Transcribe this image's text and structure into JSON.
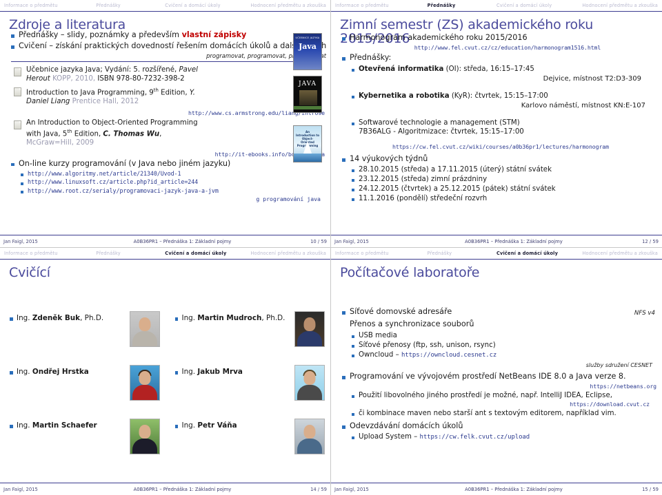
{
  "nav": {
    "items": [
      "Informace o předmětu",
      "Přednášky",
      "Cvičení a domácí úkoly",
      "Hodnocení předmětu a zkouška"
    ]
  },
  "footer": {
    "author": "Jan Faigl, 2015",
    "center": "A0B36PR1 – Přednáška 1: Základní pojmy"
  },
  "slides": [
    {
      "title": "Zdroje a literatura",
      "active_nav": 0,
      "page": "10 / 59",
      "bullets": [
        {
          "pre": "Přednášky – slidy, poznámky a především ",
          "red": "vlastní zápisky"
        },
        {
          "pre": "Cvičení – získání praktických dovedností řešením domácích úkolů a dalších úloh"
        }
      ],
      "note_right": "programovat, programovat, programovat",
      "books": [
        {
          "line1_plain": "Učebnice jazyka Java; Vydání: 5. rozšířené, ",
          "line1_ital": "Pavel",
          "line2_ital": "Herout",
          "line2_gray": "KOPP, 2010,",
          "line2_plain": " ISBN 978-80-7232-398-2",
          "url": ""
        },
        {
          "line1_plain": "Introduction to Java Programming, 9",
          "sup": "th",
          "line1_rest": " Edition, ",
          "line1_ital": "Y.",
          "line2_ital": "Daniel Liang",
          "line2_gray": "Prentice Hall, 2012",
          "url": "http://www.cs.armstrong.edu/liang/intro9e"
        },
        {
          "line1_plain": "An Introduction to Object-Oriented Programming",
          "line2_plain": "with Java, 5",
          "sup": "th",
          "line2_rest": " Edition, ",
          "line2_ital": "C. Thomas Wu",
          "line3_gray": "McGraw=Hill, 2009",
          "url": "http://it-ebooks.info/book/1908/a"
        }
      ],
      "online": {
        "heading": "On-line kurzy programování (v Java nebo jiném jazyku)",
        "links": [
          "http://www.algoritmy.net/article/21340/Uvod-1",
          "http://www.linuxsoft.cz/article.php?id_article=244",
          "http://www.root.cz/serialy/programovaci-jazyk-java-a-jvm"
        ],
        "trailing": "g programování java"
      },
      "covers": [
        {
          "name": "ucebnice-jazyka-java-cover",
          "label": "Java",
          "sub": "UČEBNICE JAZYKA"
        },
        {
          "name": "intro-java-programming-cover",
          "label": "JAVA"
        },
        {
          "name": "intro-oop-java-cover",
          "label": "An Introduction to Object-Oriented Programming"
        }
      ]
    },
    {
      "title": "Zimní semestr (ZS) akademického roku 2015/2016",
      "active_nav": 1,
      "page": "12 / 59",
      "harmonogram_label": "Harmonogram akademického roku 2015/2016",
      "harmonogram_url": "http://www.fel.cvut.cz/cz/education/harmonogram1516.html",
      "lectures_label": "Přednášky:",
      "lectures": [
        {
          "bold": "Otevřená informatika",
          "rest": " (OI): středa, 16:15–17:45",
          "room": "Dejvice, místnost T2:D3-309"
        },
        {
          "bold": "Kybernetika a robotika",
          "rest": " (KyR): čtvrtek, 15:15–17:00",
          "room": "Karlovo náměstí, místnost KN:E-107"
        },
        {
          "bold": "",
          "rest": "Softwarové technologie a management (STM)",
          "line2": "7B36ALG - Algoritmizace: čtvrtek, 15:15–17:00",
          "room": ""
        }
      ],
      "lectures_url": "https://cw.fel.cvut.cz/wiki/courses/a0b36pr1/lectures/harmonogram",
      "weeks_label": "14 výukových týdnů",
      "weeks": [
        "28.10.2015 (středa) a 17.11.2015 (úterý) státní svátek",
        "23.12.2015 (středa) zimní prázdniny",
        "24.12.2015 (čtvrtek) a 25.12.2015 (pátek) státní svátek",
        "11.1.2016 (pondělí) středeční rozvrh"
      ]
    },
    {
      "title": "Cvičící",
      "active_nav": 2,
      "page": "14 / 59",
      "people": [
        {
          "prefix": "Ing. ",
          "name": "Zdeněk Buk",
          "suffix": ", Ph.D.",
          "photo": "photo-zdenek-buk"
        },
        {
          "prefix": "Ing. ",
          "name": "Martin Mudroch",
          "suffix": ", Ph.D.",
          "photo": "photo-martin-mudroch"
        },
        {
          "prefix": "Ing. ",
          "name": "Ondřej Hrstka",
          "suffix": "",
          "photo": "photo-ondrej-hrstka"
        },
        {
          "prefix": "Ing. ",
          "name": "Jakub Mrva",
          "suffix": "",
          "photo": "photo-jakub-mrva"
        },
        {
          "prefix": "Ing. ",
          "name": "Martin Schaefer",
          "suffix": "",
          "photo": "photo-martin-schaefer"
        },
        {
          "prefix": "Ing. ",
          "name": "Petr Váňa",
          "suffix": "",
          "photo": "photo-petr-vana"
        }
      ]
    },
    {
      "title": "Počítačové laboratoře",
      "active_nav": 2,
      "page": "15 / 59",
      "net_home": "Síťové domovské adresáře",
      "nfs": "NFS v4",
      "transfer_label": "Přenos a synchronizace souborů",
      "transfer_items": [
        {
          "text": "USB media"
        },
        {
          "text": "Síťové přenosy (ftp, ssh, unison, rsync)"
        },
        {
          "text": "Owncloud – ",
          "url": "https://owncloud.cesnet.cz"
        }
      ],
      "cesnet_note": "služby sdružení CESNET",
      "netbeans_label": "Programování ve vývojovém prostředí NetBeans IDE 8.0 a Java verze 8.",
      "netbeans_url": "https://netbeans.org",
      "other_env": "Použití libovolného jiného prostředí je možné, např. IntelliJ IDEA, Eclipse,",
      "download_url": "https://download.cvut.cz",
      "maven_line": "či kombinace maven nebo starší ant s textovým editorem, například vim.",
      "upload_label": "Odevzdávání domácích úkolů",
      "upload_item": "Upload System – ",
      "upload_url": "https://cw.felk.cvut.cz/upload"
    }
  ]
}
